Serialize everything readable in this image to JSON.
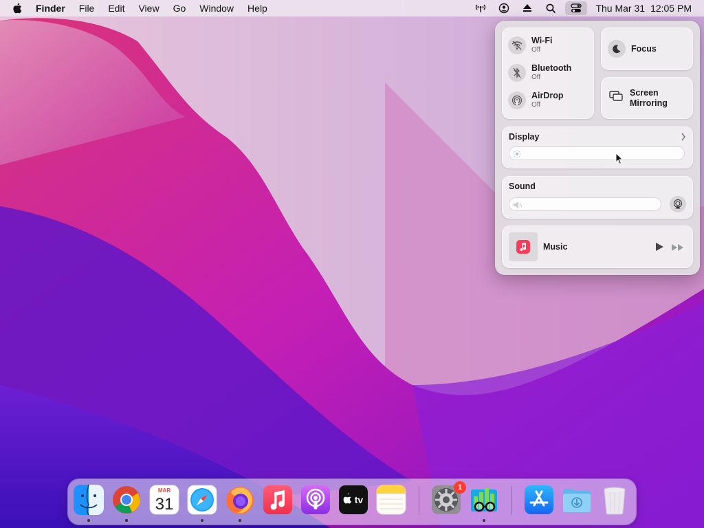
{
  "menubar": {
    "apple_icon": "apple-logo-icon",
    "app_name": "Finder",
    "menus": [
      "File",
      "Edit",
      "View",
      "Go",
      "Window",
      "Help"
    ],
    "status_icons": [
      "radio-antenna-icon",
      "user-circle-icon",
      "eject-icon",
      "search-icon",
      "control-center-icon"
    ],
    "date": "Thu Mar 31",
    "time": "12:05 PM"
  },
  "control_center": {
    "wifi": {
      "title": "Wi-Fi",
      "status": "Off"
    },
    "bluetooth": {
      "title": "Bluetooth",
      "status": "Off"
    },
    "airdrop": {
      "title": "AirDrop",
      "status": "Off"
    },
    "focus": {
      "label": "Focus"
    },
    "screen_mirroring": {
      "label": "Screen Mirroring"
    },
    "display": {
      "title": "Display",
      "level": 0
    },
    "sound": {
      "title": "Sound",
      "level": 0
    },
    "music": {
      "title": "Music"
    }
  },
  "dock": {
    "apps": [
      {
        "name": "Finder",
        "running": true
      },
      {
        "name": "Google Chrome",
        "running": true
      },
      {
        "name": "Calendar",
        "running": false,
        "month": "MAR",
        "day": "31"
      },
      {
        "name": "Safari",
        "running": true
      },
      {
        "name": "Firefox",
        "running": true
      },
      {
        "name": "Music",
        "running": false
      },
      {
        "name": "Podcasts",
        "running": false
      },
      {
        "name": "TV",
        "running": false,
        "label": "tv"
      },
      {
        "name": "Notes",
        "running": false
      },
      {
        "name": "System Preferences",
        "running": false,
        "badge": "1"
      },
      {
        "name": "Magnifying Glasses App",
        "running": true
      },
      {
        "name": "App Store",
        "running": false
      },
      {
        "name": "Downloads",
        "running": false
      },
      {
        "name": "Trash",
        "running": false
      }
    ]
  },
  "colors": {
    "accent_red": "#ff3b30",
    "menubar_bg": "#eee8f0",
    "cc_bg": "#e2dee2"
  }
}
